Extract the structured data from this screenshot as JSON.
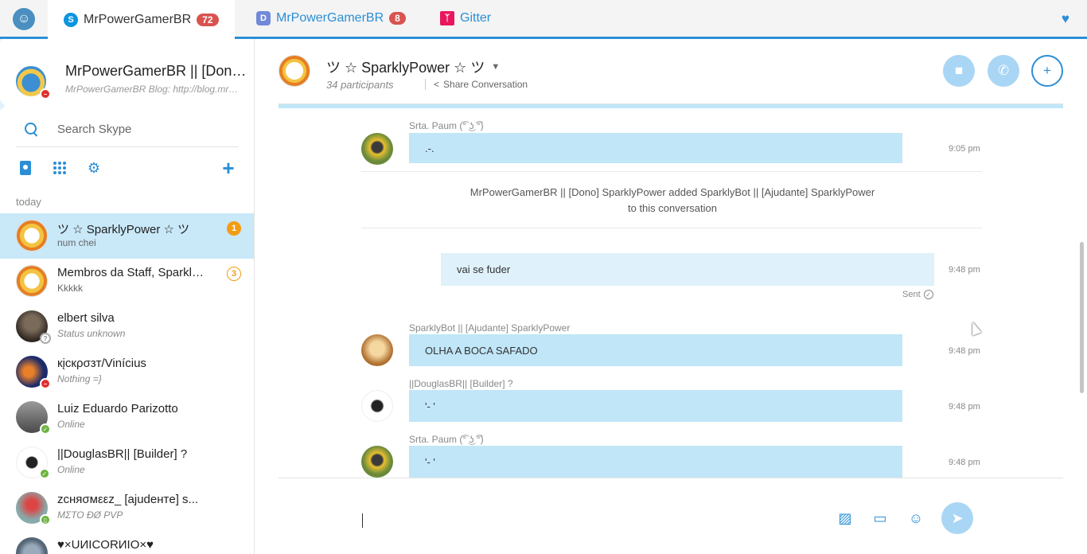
{
  "tabs": [
    {
      "label": "MrPowerGamerBR",
      "badge": "72",
      "icon": "skype-icon",
      "color": "#0a95e0"
    },
    {
      "label": "MrPowerGamerBR",
      "badge": "8",
      "icon": "discord-icon",
      "color": "#7289da"
    },
    {
      "label": "Gitter",
      "badge": "",
      "icon": "gitter-icon",
      "color": "#e8175d"
    }
  ],
  "profile": {
    "name": "MrPowerGamerBR || [Dono] SparklyPower",
    "mood": "MrPowerGamerBR Blog: http://blog.mrpowergamerbr.com"
  },
  "search": {
    "placeholder": "Search Skype"
  },
  "sidebar": {
    "section_label": "today",
    "conversations": [
      {
        "name": "ツ ☆ SparklyPower ☆ ツ",
        "subtitle": "num chei",
        "unread": "1",
        "status": "none"
      },
      {
        "name": "Membros da Staff, SparklyPower",
        "subtitle": "Kkkkk",
        "unread": "3",
        "status": "none"
      },
      {
        "name": "elbert silva",
        "subtitle": "Status unknown",
        "unread": "",
        "status": "unknown"
      },
      {
        "name": "кįcкρσзт/Vinícius",
        "subtitle": "Nothing =}",
        "unread": "",
        "status": "dnd"
      },
      {
        "name": "Luiz Eduardo Parizotto",
        "subtitle": "Online",
        "unread": "",
        "status": "online"
      },
      {
        "name": "||DouglasBR|| [Builder] ?",
        "subtitle": "Online",
        "unread": "",
        "status": "online"
      },
      {
        "name": "zcняσмεεz_ [ajudeнтe] s...",
        "subtitle": "MΣTO ĐØ PVP",
        "unread": "",
        "status": "online"
      },
      {
        "name": "♥×UИICORИIO×♥",
        "subtitle": "",
        "unread": "",
        "status": "none"
      }
    ]
  },
  "conversation": {
    "title": "ツ ☆ SparklyPower ☆ ツ",
    "participants": "34 participants",
    "share_label": "Share Conversation"
  },
  "messages": [
    {
      "type": "msg",
      "sender": "Srta. Paum (͡° ͜ʖ ͡°)",
      "text": ".-.",
      "time": "9:05 pm"
    },
    {
      "type": "system",
      "text": "MrPowerGamerBR || [Dono] SparklyPower added SparklyBot || [Ajudante] SparklyPower to this conversation"
    },
    {
      "type": "mine",
      "text": "vai se fuder",
      "time": "9:48 pm",
      "status": "Sent"
    },
    {
      "type": "msg",
      "sender": "SparklyBot || [Ajudante] SparklyPower",
      "text": "OLHA A BOCA SAFADO",
      "time": "9:48 pm"
    },
    {
      "type": "msg",
      "sender": "||DouglasBR|| [Builder] ?",
      "text": "'- '",
      "time": "9:48 pm"
    },
    {
      "type": "msg",
      "sender": "Srta. Paum (͡° ͜ʖ ͡°)",
      "text": "'- '",
      "time": "9:48 pm"
    }
  ],
  "composer": {
    "value": ""
  },
  "colors": {
    "accent": "#2b8fd6",
    "bubble": "#c0e6f8",
    "selected": "#c9e8f8",
    "badge": "#d9534f",
    "unread": "#f39c12"
  }
}
